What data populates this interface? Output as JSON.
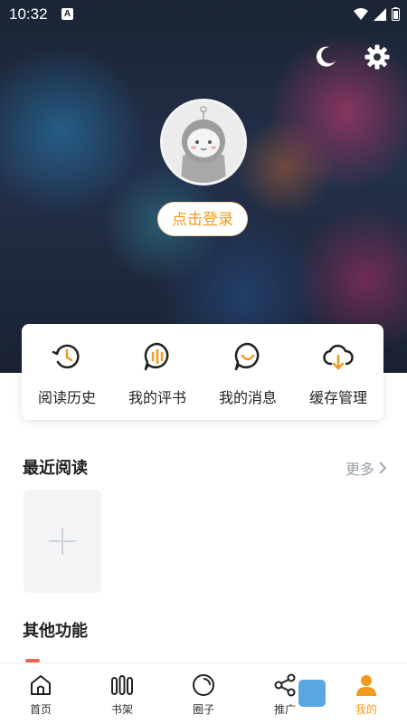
{
  "status_bar": {
    "time": "10:32",
    "indicator": "A"
  },
  "header": {
    "icons": [
      "moon-icon",
      "gear-icon"
    ],
    "login_label": "点击登录"
  },
  "quick_actions": [
    {
      "label": "阅读历史",
      "icon": "clock-history-icon"
    },
    {
      "label": "我的评书",
      "icon": "chat-bars-icon"
    },
    {
      "label": "我的消息",
      "icon": "message-smile-icon"
    },
    {
      "label": "缓存管理",
      "icon": "cloud-download-icon"
    }
  ],
  "recent": {
    "title": "最近阅读",
    "more_label": "更多"
  },
  "other": {
    "title": "其他功能"
  },
  "bottom_nav": [
    {
      "label": "首页",
      "icon": "home-icon"
    },
    {
      "label": "书架",
      "icon": "bookshelf-icon"
    },
    {
      "label": "圈子",
      "icon": "circle-icon"
    },
    {
      "label": "推广",
      "icon": "share-icon"
    },
    {
      "label": "我的",
      "icon": "user-icon"
    }
  ],
  "colors": {
    "accent": "#f29a1d",
    "text": "#222222",
    "muted": "#9aa0aa"
  }
}
